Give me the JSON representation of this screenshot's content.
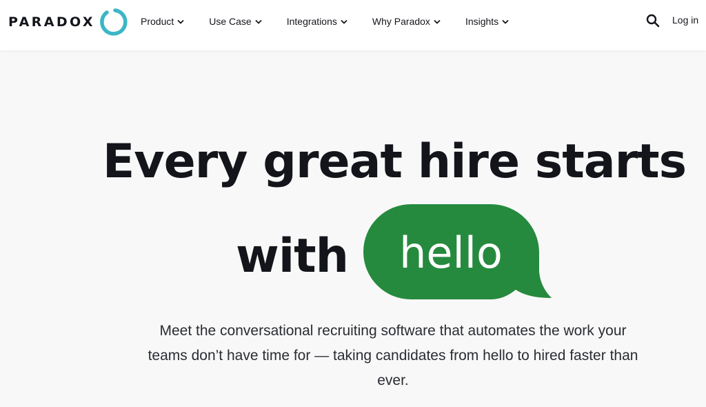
{
  "brand": {
    "name": "PARADOX",
    "ring_color": "#3cb6c7"
  },
  "nav": {
    "items": [
      {
        "label": "Product",
        "icon": "chevron-down-icon"
      },
      {
        "label": "Use Case",
        "icon": "chevron-down-icon"
      },
      {
        "label": "Integrations",
        "icon": "chevron-down-icon"
      },
      {
        "label": "Why Paradox",
        "icon": "chevron-down-icon"
      },
      {
        "label": "Insights",
        "icon": "chevron-down-icon"
      }
    ],
    "search_icon": "search-icon",
    "login_label": "Log in"
  },
  "hero": {
    "headline_line1": "Every great hire starts",
    "headline_with": "with",
    "bubble_text": "hello",
    "bubble_color": "#268a3e",
    "subtext": "Meet the conversational recruiting software that automates the work your teams don’t have time for — taking candidates from hello to hired faster than ever."
  }
}
